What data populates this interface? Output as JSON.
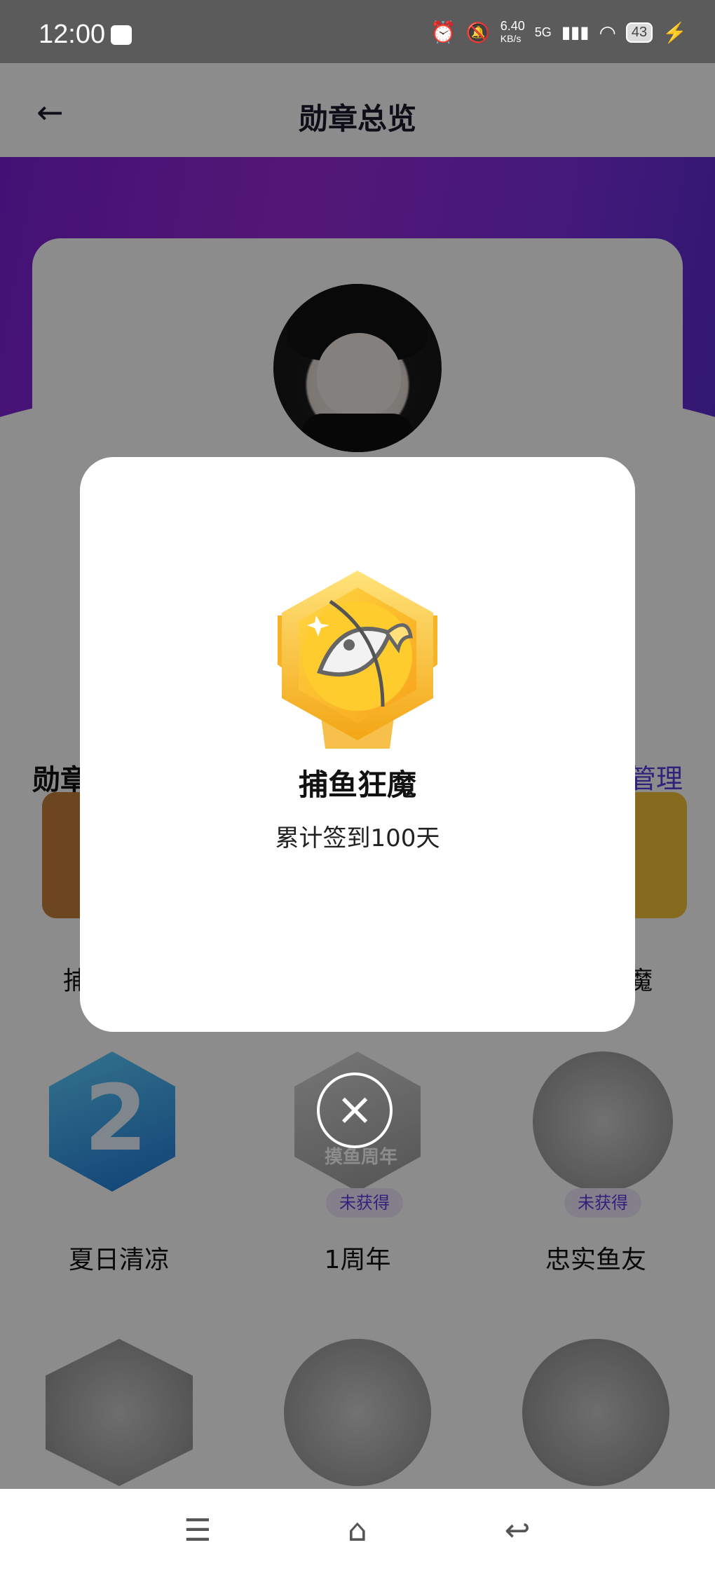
{
  "status_bar": {
    "time": "12:00",
    "net_speed": "6.40",
    "net_unit": "KB/s",
    "signal": "5G",
    "battery": "43"
  },
  "header": {
    "title": "勋章总览"
  },
  "section": {
    "title": "勋章",
    "manage": "管理"
  },
  "badges": [
    {
      "name": "夏日清凉",
      "status": ""
    },
    {
      "name": "1周年",
      "status": "未获得",
      "inner_text": "摸鱼周年"
    },
    {
      "name": "忠实鱼友",
      "status": "未获得"
    }
  ],
  "partial_badges": {
    "left_name_fragment": "捕",
    "right_name_fragment": "魔"
  },
  "modal": {
    "title": "捕鱼狂魔",
    "description": "累计签到100天"
  },
  "icons": {
    "back": "arrow-left-icon",
    "close": "close-icon",
    "menu": "menu-icon",
    "home": "home-icon",
    "back_nav": "back-nav-icon"
  }
}
